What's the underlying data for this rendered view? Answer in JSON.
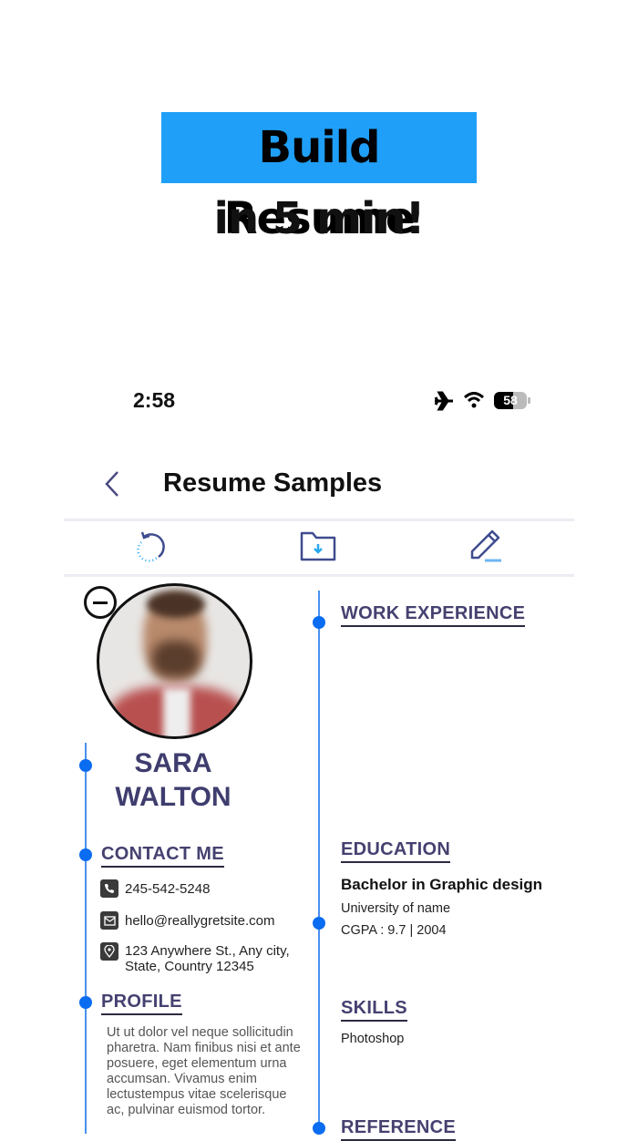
{
  "promo": {
    "line1": "Build Resume",
    "line2": "in 5 min!",
    "highlight_color": "#1f9ff7"
  },
  "status_bar": {
    "time": "2:58",
    "battery": "58"
  },
  "nav": {
    "title": "Resume Samples"
  },
  "toolbar": {
    "icons": [
      "reset-icon",
      "download-folder-icon",
      "edit-pencil-icon"
    ]
  },
  "resume": {
    "first_name": "SARA",
    "last_name": "WALTON",
    "contact": {
      "heading": "CONTACT ME",
      "phone": "245-542-5248",
      "email": "hello@reallygretsite.com",
      "address_line1": "123 Anywhere St., Any city,",
      "address_line2": "State, Country 12345"
    },
    "profile": {
      "heading": "PROFILE",
      "text": "Ut ut dolor vel neque sollicitudin pharetra. Nam finibus nisi et ante posuere, eget elementum urna accumsan. Vivamus enim lectustempus vitae scelerisque ac, pulvinar euismod tortor."
    },
    "work": {
      "heading": "WORK EXPERIENCE"
    },
    "education": {
      "heading": "EDUCATION",
      "degree": "Bachelor in Graphic design",
      "school": "University of name",
      "gpa": "CGPA : 9.7 | 2004"
    },
    "skills": {
      "heading": "SKILLS",
      "items": [
        "Photoshop"
      ]
    },
    "reference": {
      "heading": "REFERENCE"
    }
  }
}
